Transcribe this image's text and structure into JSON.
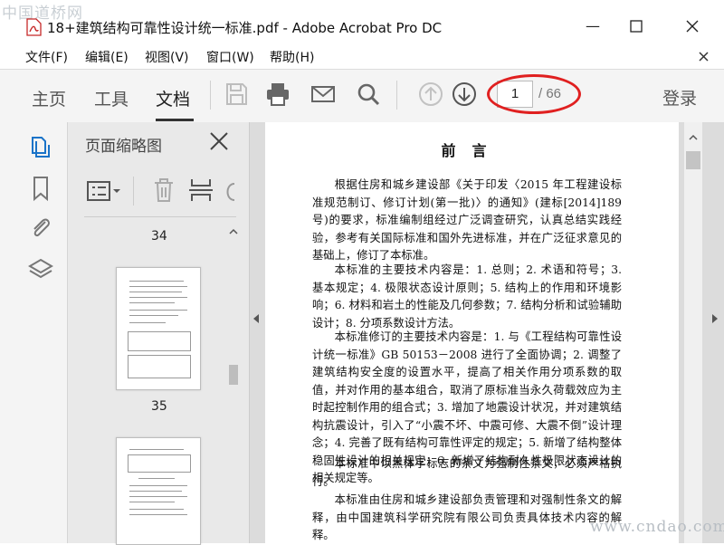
{
  "window": {
    "title": "18+建筑结构可靠性设计统一标准.pdf - Adobe Acrobat Pro DC",
    "watermark_top": "中国道桥网",
    "watermark_bottom": "www.cndao.com"
  },
  "menu": [
    "文件(F)",
    "编辑(E)",
    "视图(V)",
    "窗口(W)",
    "帮助(H)"
  ],
  "toolbar": {
    "tabs": [
      "主页",
      "工具",
      "文档"
    ],
    "active_tab": "文档",
    "page_current": "1",
    "page_total": "/ 66",
    "login": "登录"
  },
  "thumbnails": {
    "title": "页面缩略图",
    "pages": [
      "34",
      "35"
    ]
  },
  "document": {
    "heading": "前言",
    "paragraphs": [
      "根据住房和城乡建设部《关于印发〈2015 年工程建设标准规范制订、修订计划(第一批)〉的通知》(建标[2014]189 号)的要求，标准编制组经过广泛调查研究，认真总结实践经验，参考有关国际标准和国外先进标准，并在广泛征求意见的基础上，修订了本标准。",
      "本标准的主要技术内容是：1. 总则；2. 术语和符号；3. 基本规定；4. 极限状态设计原则；5. 结构上的作用和环境影响；6. 材料和岩土的性能及几何参数；7. 结构分析和试验辅助设计；8. 分项系数设计方法。",
      "本标准修订的主要技术内容是：1. 与《工程结构可靠性设计统一标准》GB 50153－2008 进行了全面协调；2. 调整了建筑结构安全度的设置水平，提高了相关作用分项系数的取值，并对作用的基本组合，取消了原标准当永久荷载效应为主时起控制作用的组合式；3. 增加了地震设计状况，并对建筑结构抗震设计，引入了“小震不坏、中震可修、大震不倒”设计理念；4. 完善了既有结构可靠性评定的规定；5. 新增了结构整体稳固性设计的相关规定；6. 新增了结构耐久性极限状态设计的相关规定等。",
      "本标准中以黑体字标志的条文为强制性条文，必须严格执行。",
      "本标准由住房和城乡建设部负责管理和对强制性条文的解释，由中国建筑科学研究院有限公司负责具体技术内容的解释。"
    ]
  },
  "colors": {
    "annotation": "#e02020",
    "toolbar_bg": "#f4f4f4",
    "panel_bg": "#e9e9e9",
    "accent_icon": "#1a73c8"
  }
}
